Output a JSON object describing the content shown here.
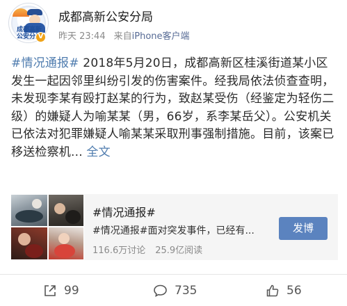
{
  "account": {
    "name": "成都高新公安分局",
    "avatar_text_line1": "成都高新",
    "avatar_text_line2": "公安分局",
    "verified_badge": "V",
    "badge_color": "#f0a318"
  },
  "post": {
    "time": "昨天 23:44",
    "source_prefix": "来自",
    "source_name": "iPhone客户端",
    "hashtag": "#情况通报#",
    "body": " 2018年5月20日，成都高新区桂溪街道某小区发生一起因邻里纠纷引发的伤害案件。经我局依法侦查查明，未发现李某有殴打赵某的行为，致赵某受伤（经鉴定为轻伤二级）的嫌疑人为喻某某（男，66岁，系李某岳父）。公安机关已依法对犯罪嫌疑人喻某某采取刑事强制措施。目前，该案已移送检察机...",
    "expand_label": "全文",
    "link_color": "#507daf"
  },
  "card": {
    "title": "#情况通报#",
    "description": "#情况通报#面对突发事件，已经有...",
    "discussions": "116.6万讨论",
    "reads": "25.9亿阅读",
    "button_label": "发博",
    "button_color": "#5b83bf"
  },
  "actions": {
    "repost_icon": "repost-icon",
    "repost_count": "99",
    "comment_icon": "comment-icon",
    "comment_count": "735",
    "like_icon": "like-icon",
    "like_count": "56"
  }
}
